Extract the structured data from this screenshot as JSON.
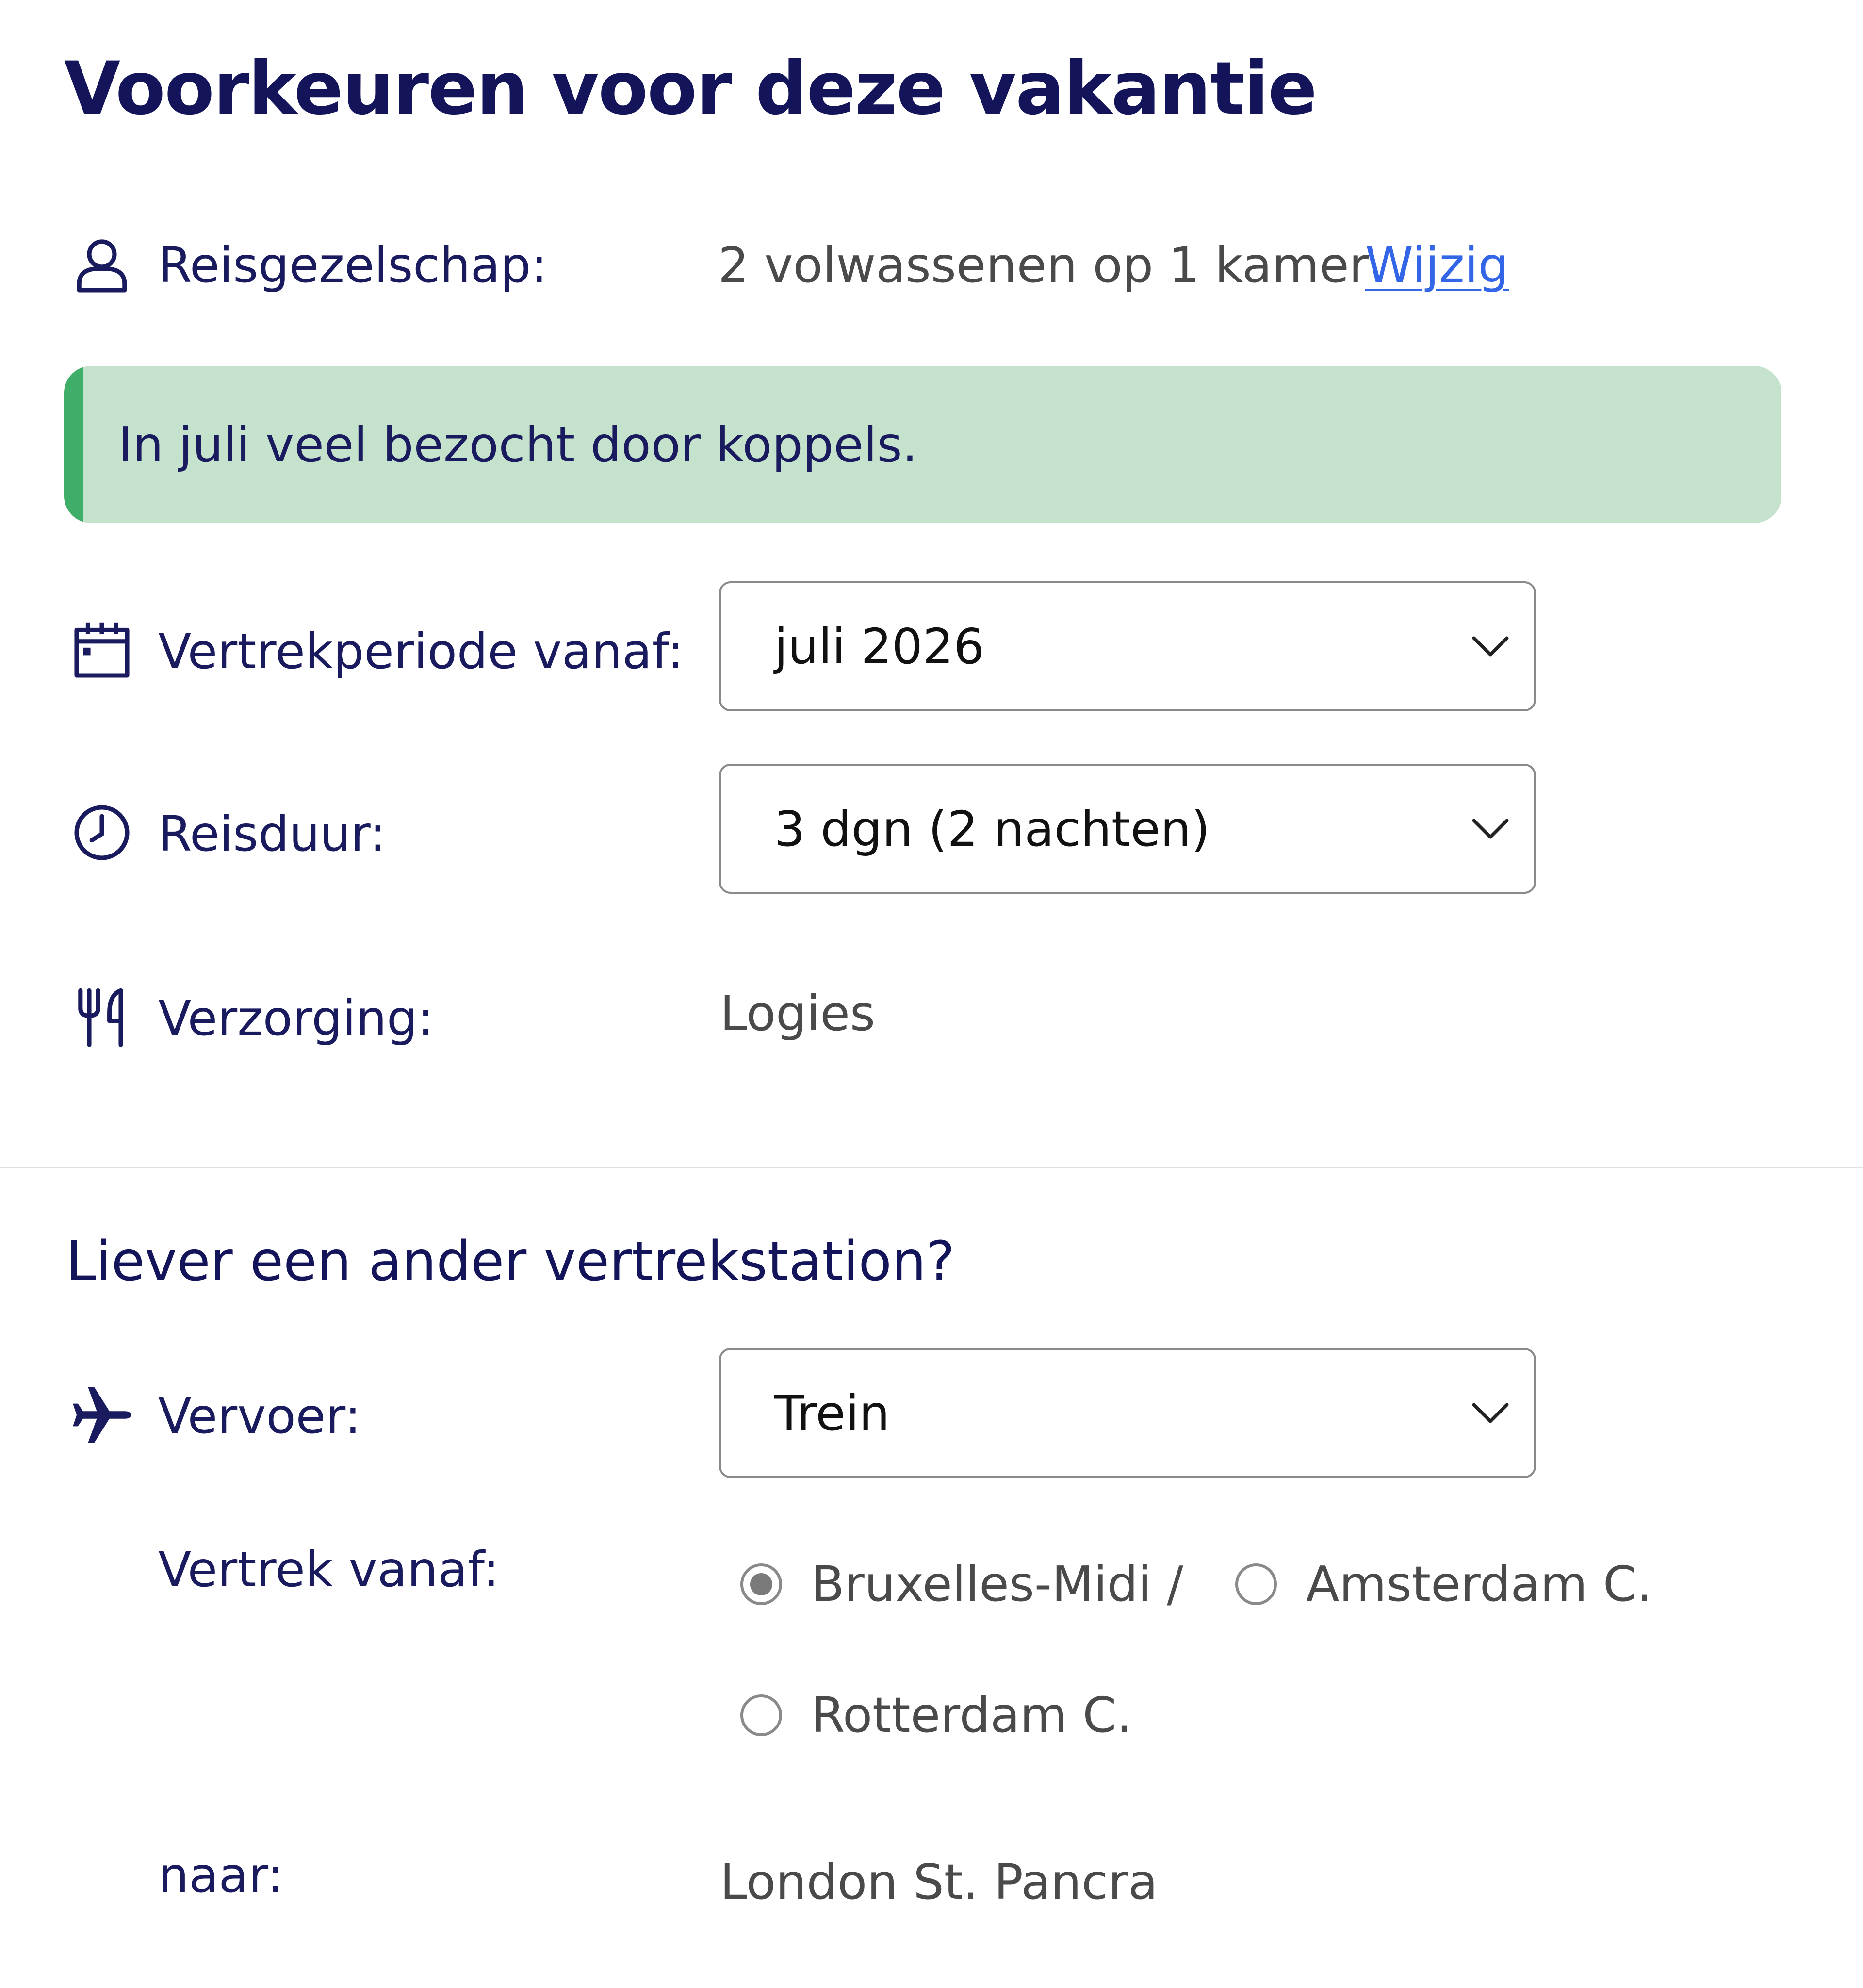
{
  "page": {
    "title": "Voorkeuren voor deze vakantie"
  },
  "travel_party": {
    "icon": "person-icon",
    "label": "Reisgezelschap:",
    "value": "2 volwassenen op 1 kamer",
    "change_link": "Wijzig"
  },
  "notice": {
    "text": "In juli veel bezocht door koppels.",
    "accent_color": "#3fae68",
    "background_color": "#c5e3cc"
  },
  "departure_period": {
    "icon": "calendar-icon",
    "label": "Vertrekperiode vanaf:",
    "selected": "juli 2026"
  },
  "duration": {
    "icon": "clock-icon",
    "label": "Reisduur:",
    "selected": "3 dgn (2 nachten)"
  },
  "board": {
    "icon": "cutlery-icon",
    "label": "Verzorging:",
    "value": "Logies"
  },
  "station_section": {
    "title": "Liever een ander vertrekstation?"
  },
  "transport": {
    "icon": "airplane-icon",
    "label": "Vervoer:",
    "selected": "Trein"
  },
  "departure_from": {
    "label": "Vertrek vanaf:",
    "options": [
      {
        "label": "Bruxelles-Midi /",
        "checked": true
      },
      {
        "label": "Amsterdam C.",
        "checked": false
      },
      {
        "label": "Rotterdam C.",
        "checked": false
      }
    ]
  },
  "destination": {
    "label": "naar:",
    "value": "London St. Pancra"
  },
  "colors": {
    "heading": "#14145a",
    "link": "#3366e6",
    "text_muted": "#4a4a4a"
  }
}
